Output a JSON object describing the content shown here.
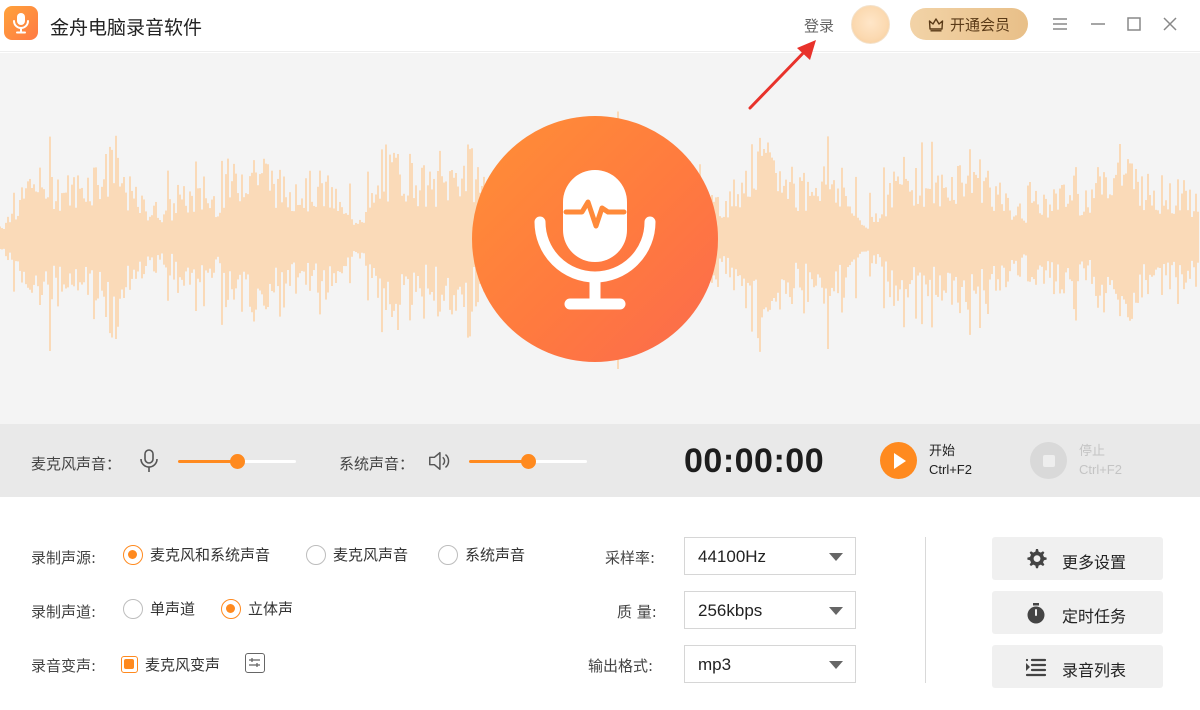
{
  "app": {
    "title": "金舟电脑录音软件",
    "login_label": "登录",
    "vip_label": "开通会员",
    "icons": {
      "logo": "microphone-logo-icon",
      "vip": "crown-icon",
      "menu": "menu-icon",
      "minimize": "minimize-icon",
      "maximize": "maximize-icon",
      "close": "close-icon"
    }
  },
  "hero": {
    "record_button_icon": "microphone-waveform-icon"
  },
  "controls": {
    "mic_volume": {
      "label": "麦克风声音：",
      "icon": "microphone-icon",
      "level": 0.5
    },
    "system_volume": {
      "label": "系统声音：",
      "icon": "speaker-icon",
      "level": 0.5
    },
    "timer": "00:00:00",
    "start": {
      "label": "开始",
      "shortcut": "Ctrl+F2",
      "icon": "play-icon"
    },
    "stop": {
      "label": "停止",
      "shortcut": "Ctrl+F2",
      "icon": "stop-icon"
    }
  },
  "settings": {
    "source": {
      "label": "录制声源:",
      "options": [
        "麦克风和系统声音",
        "麦克风声音",
        "系统声音"
      ],
      "selected": "麦克风和系统声音"
    },
    "channel": {
      "label": "录制声道:",
      "options": [
        "单声道",
        "立体声"
      ],
      "selected": "立体声"
    },
    "voice_change": {
      "label": "录音变声:",
      "checkbox_label": "麦克风变声",
      "checked": true,
      "adjust_icon": "sliders-icon"
    },
    "sample_rate": {
      "label": "采样率:",
      "value": "44100Hz"
    },
    "quality": {
      "label": "质 量:",
      "value": "256kbps"
    },
    "format": {
      "label": "输出格式:",
      "value": "mp3"
    }
  },
  "side_buttons": [
    {
      "label": "更多设置",
      "icon": "gear-icon"
    },
    {
      "label": "定时任务",
      "icon": "timer-icon"
    },
    {
      "label": "录音列表",
      "icon": "list-icon"
    }
  ],
  "colors": {
    "accent": "#ff8a1f",
    "record_gradient_start": "#ff8f36",
    "record_gradient_end": "#fb6a4d",
    "waveform": "#fcd3a9",
    "vip_gold": "#e8bf88",
    "annotation": "#e8322b"
  }
}
